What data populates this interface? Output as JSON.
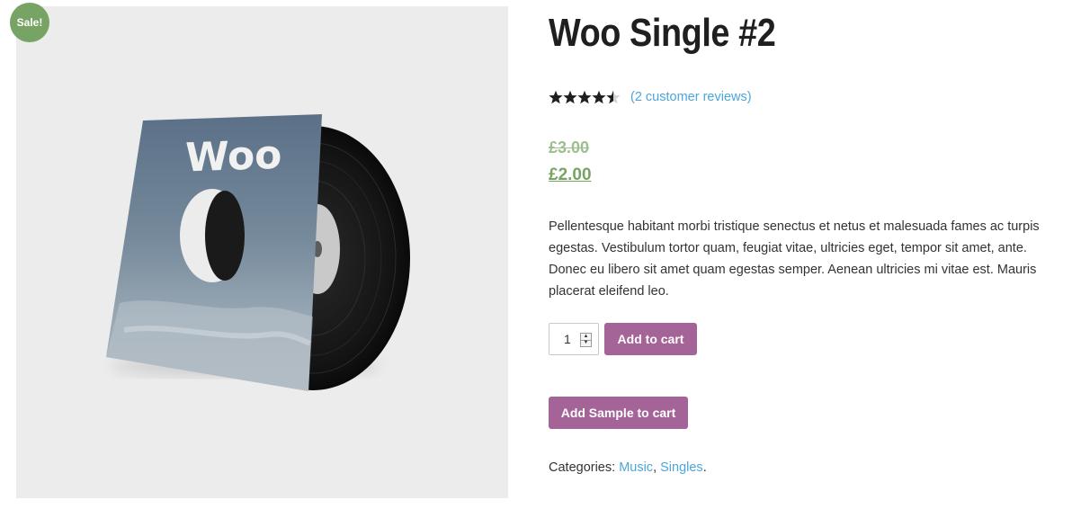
{
  "product": {
    "sale_badge": "Sale!",
    "title": "Woo Single #2",
    "rating": 4.5,
    "rating_max": 5,
    "review_link": "(2 customer reviews)",
    "price_regular": "£3.00",
    "price_sale": "£2.00",
    "description": "Pellentesque habitant morbi tristique senectus et netus et malesuada fames ac turpis egestas. Vestibulum tortor quam, feugiat vitae, ultricies eget, tempor sit amet, ante. Donec eu libero sit amet quam egestas semper. Aenean ultricies mi vitae est. Mauris placerat eleifend leo.",
    "image_cover_text": "Woo"
  },
  "cart": {
    "quantity": "1",
    "add_to_cart_label": "Add to cart",
    "add_sample_label": "Add Sample to cart"
  },
  "meta": {
    "categories_label": "Categories:",
    "categories": [
      "Music",
      "Singles"
    ],
    "separator": ", ",
    "end": "."
  },
  "colors": {
    "sale_badge": "#77a464",
    "button": "#a46497",
    "link": "#4ca6d8",
    "sale_price": "#77a464"
  },
  "icons": [
    "star-full-icon",
    "star-half-icon",
    "spin-up-icon",
    "spin-down-icon"
  ]
}
